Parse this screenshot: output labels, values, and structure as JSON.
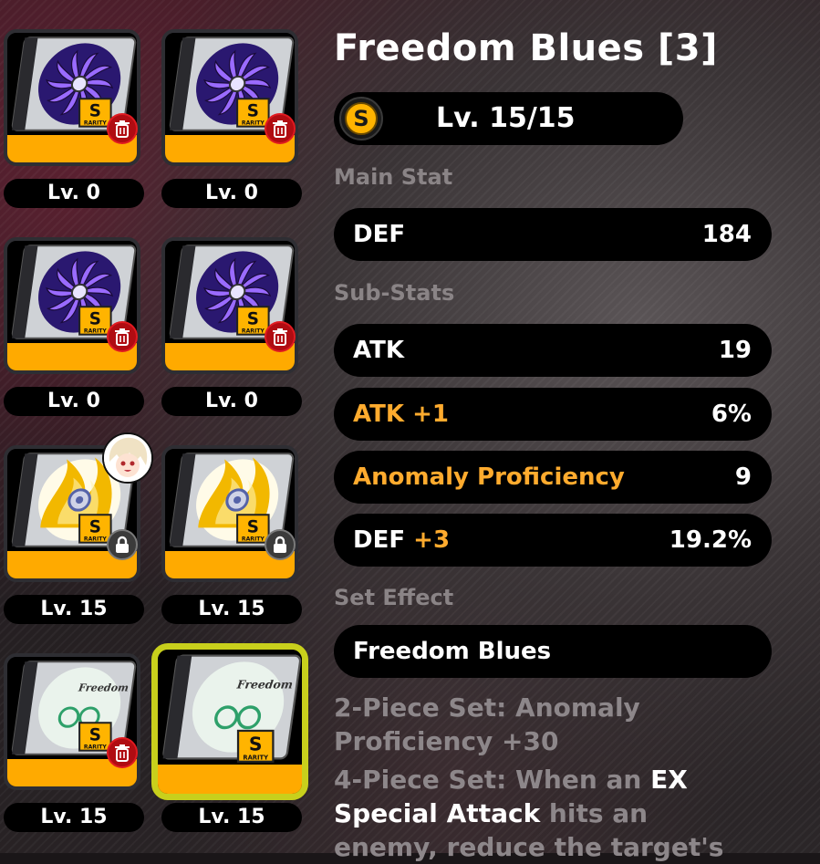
{
  "discs": [
    {
      "level_label": "Lv. 0",
      "art": "purple-fan",
      "badge": "trash",
      "selected": false,
      "equipped_avatar": false
    },
    {
      "level_label": "Lv. 0",
      "art": "purple-fan",
      "badge": "trash",
      "selected": false,
      "equipped_avatar": false
    },
    {
      "level_label": "Lv. 0",
      "art": "purple-fan",
      "badge": "trash",
      "selected": false,
      "equipped_avatar": false
    },
    {
      "level_label": "Lv. 0",
      "art": "purple-fan",
      "badge": "trash",
      "selected": false,
      "equipped_avatar": false
    },
    {
      "level_label": "Lv. 15",
      "art": "yellow-flame",
      "badge": "lock",
      "selected": false,
      "equipped_avatar": true
    },
    {
      "level_label": "Lv. 15",
      "art": "yellow-flame",
      "badge": "lock",
      "selected": false,
      "equipped_avatar": false
    },
    {
      "level_label": "Lv. 15",
      "art": "green-record",
      "badge": "trash",
      "selected": false,
      "equipped_avatar": false
    },
    {
      "level_label": "Lv. 15",
      "art": "green-record",
      "badge": "none",
      "selected": true,
      "equipped_avatar": false
    }
  ],
  "rarity_label": "RARITY",
  "rarity_grade": "S",
  "detail": {
    "title": "Freedom Blues [3]",
    "rank_icon": "s-rank-icon",
    "level_text": "Lv. 15/15",
    "main_stat_label": "Main Stat",
    "main_stat": {
      "name": "DEF",
      "value": "184"
    },
    "sub_stats_label": "Sub-Stats",
    "sub_stats": [
      {
        "name": "ATK",
        "upgrade": "",
        "value": "19",
        "highlight": false
      },
      {
        "name": "ATK",
        "upgrade": "+1",
        "value": "6%",
        "highlight": true
      },
      {
        "name": "Anomaly Proficiency",
        "upgrade": "",
        "value": "9",
        "highlight": true
      },
      {
        "name": "DEF",
        "upgrade": "+3",
        "value": "19.2%",
        "highlight": false
      }
    ],
    "set_effect_label": "Set Effect",
    "set_name": "Freedom Blues",
    "two_piece": "2-Piece Set: Anomaly Proficiency +30",
    "four_piece_a": "4-Piece Set: When an ",
    "four_piece_hl": "EX Special Attack",
    "four_piece_b": " hits an enemy, reduce the target's"
  },
  "colors": {
    "rarity_orange": "#ffaa00",
    "selected_border": "#c8d01c",
    "highlight_orange": "#ffab2e"
  }
}
